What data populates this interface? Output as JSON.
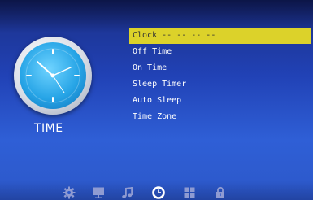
{
  "section_title": "TIME",
  "menu": {
    "items": [
      {
        "label": "Clock -- --    -- --",
        "selected": true
      },
      {
        "label": "Off Time",
        "selected": false
      },
      {
        "label": "On Time",
        "selected": false
      },
      {
        "label": "Sleep Timer",
        "selected": false
      },
      {
        "label": "Auto Sleep",
        "selected": false
      },
      {
        "label": "Time Zone",
        "selected": false
      }
    ]
  },
  "bottom_nav": [
    {
      "icon": "gear-icon",
      "active": false
    },
    {
      "icon": "monitor-icon",
      "active": false
    },
    {
      "icon": "music-note-icon",
      "active": false
    },
    {
      "icon": "clock-icon",
      "active": true
    },
    {
      "icon": "grid-icon",
      "active": false
    },
    {
      "icon": "lock-icon",
      "active": false
    }
  ],
  "colors": {
    "selection": "#dcd22a",
    "text": "#ffffff",
    "icon_inactive": "#8f9bd2",
    "icon_active": "#ffffff"
  }
}
